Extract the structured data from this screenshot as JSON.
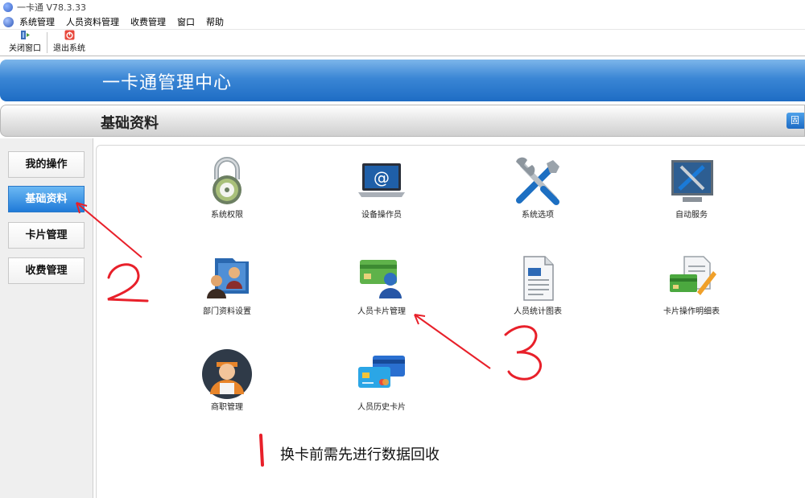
{
  "window": {
    "title": "一卡通 V78.3.33"
  },
  "menu": {
    "items": [
      "系统管理",
      "人员资料管理",
      "收费管理",
      "窗口",
      "帮助"
    ]
  },
  "toolbar": {
    "close_window": "关闭窗口",
    "exit_system": "退出系统"
  },
  "banner": {
    "title": "一卡通管理中心"
  },
  "section": {
    "title": "基础资料",
    "corner_button": "固"
  },
  "sidebar": {
    "items": [
      {
        "label": "我的操作",
        "active": false
      },
      {
        "label": "基础资料",
        "active": true
      },
      {
        "label": "卡片管理",
        "active": false
      },
      {
        "label": "收费管理",
        "active": false
      }
    ]
  },
  "functions": [
    {
      "label": "系统权限",
      "icon": "padlock-icon"
    },
    {
      "label": "设备操作员",
      "icon": "laptop-at-icon"
    },
    {
      "label": "系统选项",
      "icon": "tools-icon"
    },
    {
      "label": "自动服务",
      "icon": "monitor-tools-icon"
    },
    {
      "label": "部门资料设置",
      "icon": "folder-people-icon"
    },
    {
      "label": "人员卡片管理",
      "icon": "card-person-icon"
    },
    {
      "label": "人员统计图表",
      "icon": "document-icon"
    },
    {
      "label": "卡片操作明细表",
      "icon": "card-edit-icon"
    },
    {
      "label": "商职管理",
      "icon": "merchant-person-icon"
    },
    {
      "label": "人员历史卡片",
      "icon": "credit-cards-icon"
    }
  ],
  "annotations": {
    "num1": "1",
    "num2": "2",
    "num3": "3",
    "note": "换卡前需先进行数据回收",
    "arrow_color": "#e8202a"
  }
}
